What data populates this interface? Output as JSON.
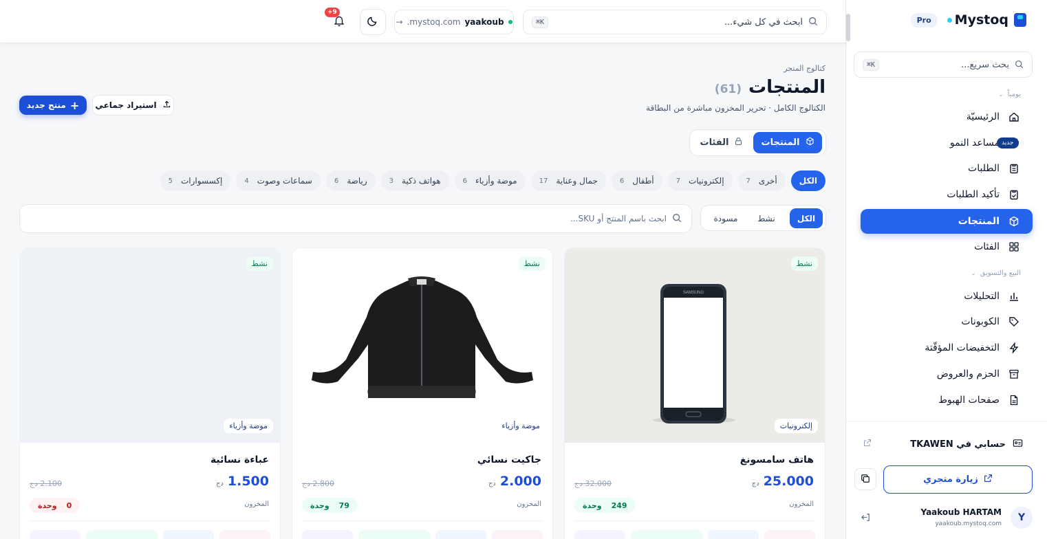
{
  "brand": {
    "name": "Mystoq",
    "plan": "Pro"
  },
  "sidebar": {
    "search_placeholder": "بحث سريع...",
    "search_kbd": "⌘K",
    "section_daily": "يومياً",
    "section_sales": "البيع والتسويق",
    "items": [
      {
        "label": "الرئيسيّة",
        "icon": "home-icon"
      },
      {
        "label": "مساعد النمو",
        "icon": "lightbulb-icon",
        "badge": "جديد"
      },
      {
        "label": "الطلبات",
        "icon": "clipboard-icon"
      },
      {
        "label": "تأكيد الطلبات",
        "icon": "clipboard-check-icon"
      },
      {
        "label": "المنتجات",
        "icon": "box-icon",
        "active": true
      },
      {
        "label": "الفئات",
        "icon": "grid-icon"
      },
      {
        "label": "التحليلات",
        "icon": "chart-icon"
      },
      {
        "label": "الكوبونات",
        "icon": "tag-icon"
      },
      {
        "label": "التخفيضات المؤقّتة",
        "icon": "bolt-icon"
      },
      {
        "label": "الحزم والعروض",
        "icon": "archive-icon"
      },
      {
        "label": "صفحات الهبوط",
        "icon": "file-icon"
      }
    ],
    "account_link": "حسابي في TKAWEN",
    "visit_store": "زيارة متجري",
    "user_name": "Yaakoub HARTAM",
    "user_email": "yaakoub.mystoq.com",
    "user_initial": "Y"
  },
  "topbar": {
    "search_placeholder": "ابحث في كل شيء...",
    "search_kbd": "⌘K",
    "store_sub": "yaakoub",
    "store_domain": ".mystoq.com",
    "notif_count": "+9"
  },
  "page": {
    "breadcrumb": "كتالوج المتجر",
    "title": "المنتجات",
    "count": "(61)",
    "subtitle": "الكتالوج الكامل · تحرير المخزون مباشرة من البطاقة",
    "new_button": "منتج جديد",
    "import_button": "استيراد جماعي",
    "tab_products": "المنتجات",
    "tab_categories": "الفئات"
  },
  "chips": [
    {
      "label": "الكل",
      "count": "",
      "active": true
    },
    {
      "label": "أخرى",
      "count": "7"
    },
    {
      "label": "إلكترونيات",
      "count": "7"
    },
    {
      "label": "أطفال",
      "count": "6"
    },
    {
      "label": "جمال وعناية",
      "count": "17"
    },
    {
      "label": "موضة وأزياء",
      "count": "6"
    },
    {
      "label": "هواتف ذكية",
      "count": "3"
    },
    {
      "label": "رياضة",
      "count": "6"
    },
    {
      "label": "سماعات وصوت",
      "count": "4"
    },
    {
      "label": "إكسسوارات",
      "count": "5"
    }
  ],
  "filters": {
    "search_placeholder": "ابحث باسم المنتج أو SKU...",
    "status_all": "الكل",
    "status_active": "نشط",
    "status_draft": "مسودة"
  },
  "products": [
    {
      "name": "هاتف سامسونغ",
      "category": "إلكترونيات",
      "status": "نشط",
      "price": "25.000",
      "currency": "دج",
      "old_price": "32.000 دج",
      "stock_label": "المخزون",
      "stock": "249",
      "unit": "وحدة"
    },
    {
      "name": "جاكيت نسائي",
      "category": "موضة وأزياء",
      "status": "نشط",
      "price": "2.000",
      "currency": "دج",
      "old_price": "2.800 دج",
      "stock_label": "المخزون",
      "stock": "79",
      "unit": "وحدة"
    },
    {
      "name": "عباءة نسائية",
      "category": "موضة وأزياء",
      "status": "نشط",
      "price": "1.500",
      "currency": "دج",
      "old_price": "2.100 دج",
      "stock_label": "المخزون",
      "stock": "0",
      "unit": "وحدة"
    }
  ]
}
